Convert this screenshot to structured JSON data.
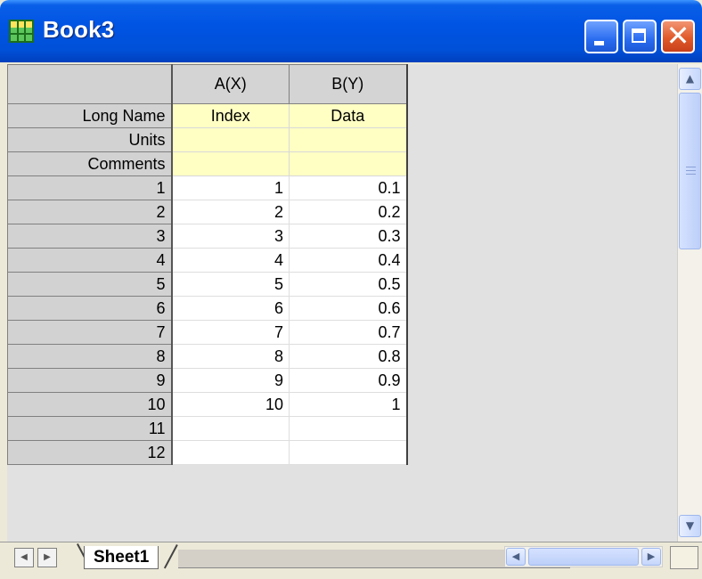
{
  "window": {
    "title": "Book3",
    "icon": "worksheet-book-icon",
    "buttons": {
      "minimize": "minimize-icon",
      "maximize": "maximize-icon",
      "close": "close-icon"
    }
  },
  "sheet": {
    "columns": [
      {
        "header": "A(X)",
        "long_name": "Index",
        "units": "",
        "comments": ""
      },
      {
        "header": "B(Y)",
        "long_name": "Data",
        "units": "",
        "comments": ""
      }
    ],
    "label_rows": [
      "Long Name",
      "Units",
      "Comments"
    ],
    "rows": [
      {
        "row": "1",
        "a": "1",
        "b": "0.1"
      },
      {
        "row": "2",
        "a": "2",
        "b": "0.2"
      },
      {
        "row": "3",
        "a": "3",
        "b": "0.3"
      },
      {
        "row": "4",
        "a": "4",
        "b": "0.4"
      },
      {
        "row": "5",
        "a": "5",
        "b": "0.5"
      },
      {
        "row": "6",
        "a": "6",
        "b": "0.6"
      },
      {
        "row": "7",
        "a": "7",
        "b": "0.7"
      },
      {
        "row": "8",
        "a": "8",
        "b": "0.8"
      },
      {
        "row": "9",
        "a": "9",
        "b": "0.9"
      },
      {
        "row": "10",
        "a": "10",
        "b": "1"
      },
      {
        "row": "11",
        "a": "",
        "b": ""
      },
      {
        "row": "12",
        "a": "",
        "b": ""
      }
    ]
  },
  "tabs": {
    "active": "Sheet1"
  },
  "colors": {
    "title_bar": "#0054e3",
    "label_cell_bg": "#ffffc4",
    "close_button": "#e05a2a"
  }
}
